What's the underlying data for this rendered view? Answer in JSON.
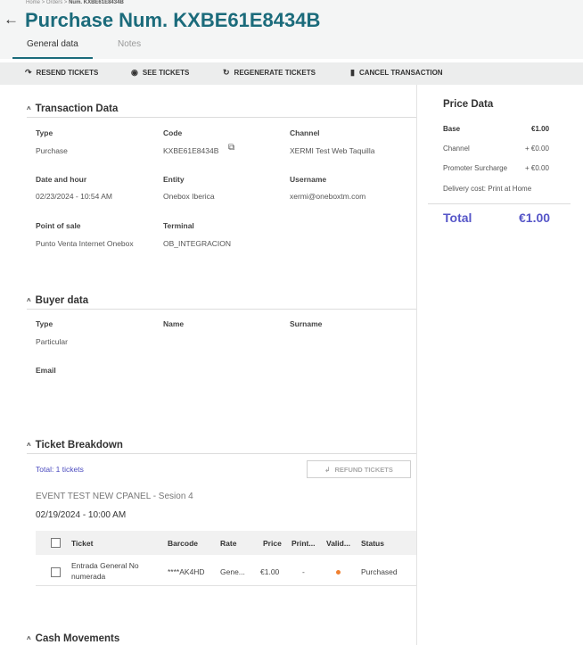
{
  "breadcrumb": {
    "home": "Home",
    "orders": "Orders",
    "current": "Num. KXBE61E8434B",
    "sep": ">"
  },
  "header": {
    "title": "Purchase Num. KXBE61E8434B"
  },
  "tabs": [
    {
      "label": "General data",
      "active": true
    },
    {
      "label": "Notes",
      "active": false
    }
  ],
  "toolbar": {
    "resend": "RESEND TICKETS",
    "see": "SEE TICKETS",
    "regenerate": "REGENERATE TICKETS",
    "cancel": "CANCEL TRANSACTION"
  },
  "transaction": {
    "title": "Transaction Data",
    "type_label": "Type",
    "type": "Purchase",
    "code_label": "Code",
    "code": "KXBE61E8434B",
    "channel_label": "Channel",
    "channel": "XERMI Test Web Taquilla",
    "date_label": "Date and hour",
    "date": "02/23/2024 - 10:54 AM",
    "entity_label": "Entity",
    "entity": "Onebox Iberica",
    "username_label": "Username",
    "username": "xermi@oneboxtm.com",
    "pos_label": "Point of sale",
    "pos": "Punto Venta Internet Onebox",
    "terminal_label": "Terminal",
    "terminal": "OB_INTEGRACION"
  },
  "buyer": {
    "title": "Buyer data",
    "type_label": "Type",
    "type": "Particular",
    "name_label": "Name",
    "surname_label": "Surname",
    "email_label": "Email"
  },
  "tickets": {
    "title": "Ticket Breakdown",
    "total": "Total: 1 tickets",
    "refund": "REFUND TICKETS",
    "event": "EVENT TEST NEW CPANEL - Sesion 4",
    "session_date": "02/19/2024 - 10:00 AM",
    "columns": [
      "Ticket",
      "Barcode",
      "Rate",
      "Price",
      "Print...",
      "Valid...",
      "Status"
    ],
    "rows": [
      {
        "ticket_line1": "Entrada General No",
        "ticket_line2": "numerada",
        "barcode": "****AK4HD",
        "rate": "Gene...",
        "price": "€1.00",
        "print": "-",
        "status": "Purchased"
      }
    ]
  },
  "cash": {
    "title": "Cash Movements"
  },
  "price": {
    "title": "Price Data",
    "base_label": "Base",
    "base": "€1.00",
    "channel_label": "Channel",
    "channel": "+ €0.00",
    "promoter_label": "Promoter Surcharge",
    "promoter": "+ €0.00",
    "delivery": "Delivery cost: Print at Home",
    "total_label": "Total",
    "total": "€1.00"
  },
  "colors": {
    "accent": "#1b6b7b",
    "total": "#5656c8",
    "valid_dot": "#f08030"
  }
}
